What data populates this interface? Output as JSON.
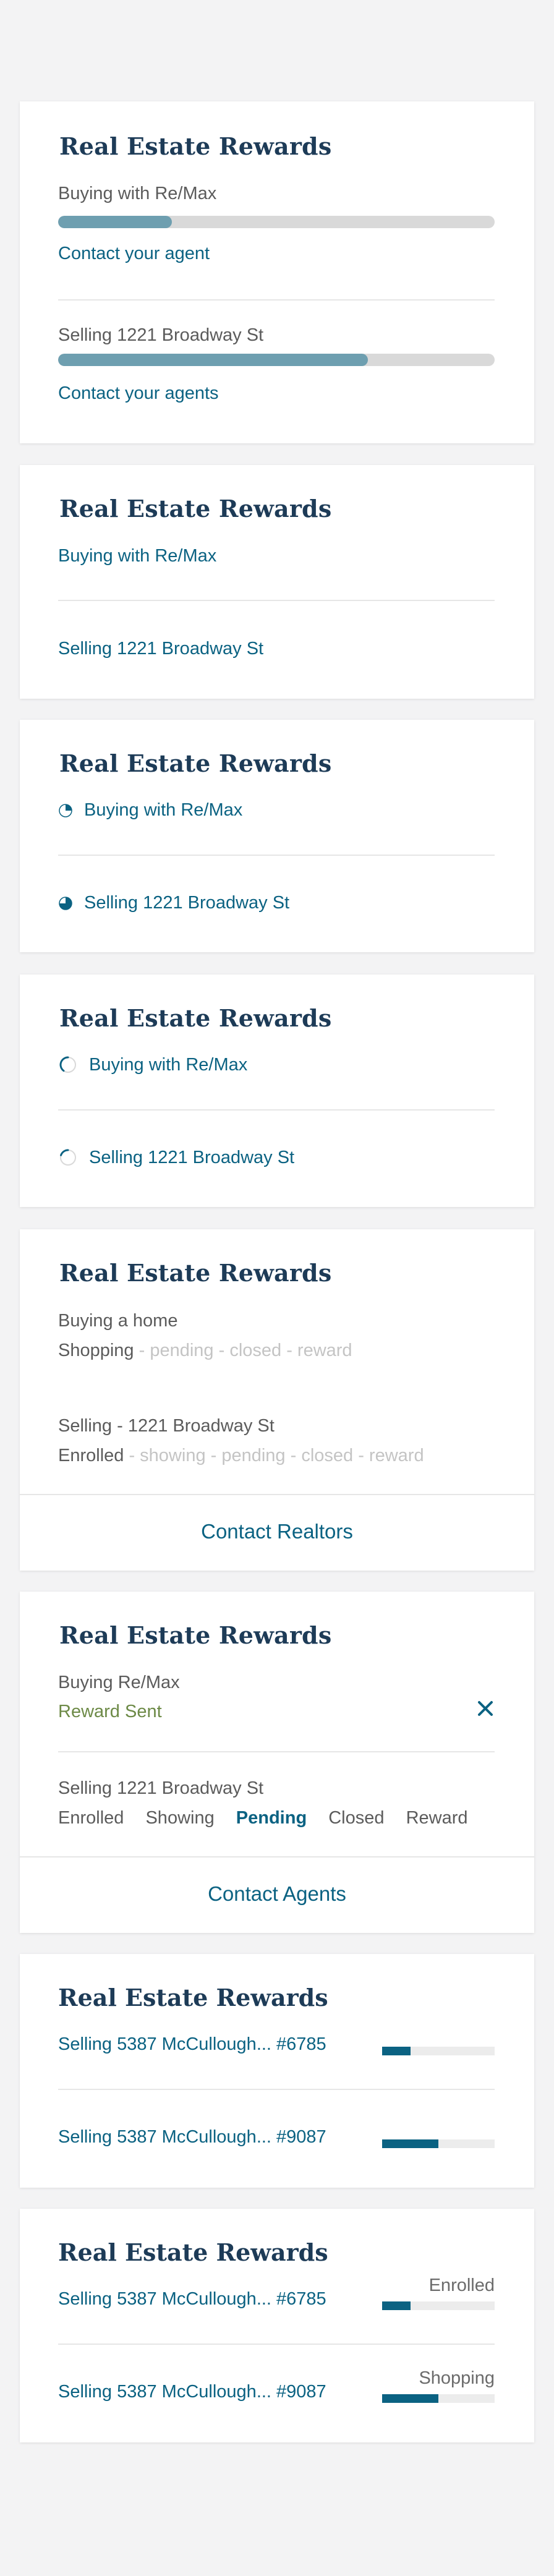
{
  "cards": [
    {
      "title": "Real Estate Rewards",
      "items": [
        {
          "label": "Buying with Re/Max",
          "progress": 0.26,
          "link": "Contact your agent"
        },
        {
          "label": "Selling 1221 Broadway St",
          "progress": 0.71,
          "link": "Contact your agents"
        }
      ]
    },
    {
      "title": "Real Estate Rewards",
      "items": [
        {
          "label": "Buying with Re/Max"
        },
        {
          "label": "Selling 1221 Broadway St"
        }
      ]
    },
    {
      "title": "Real Estate Rewards",
      "items": [
        {
          "label": "Buying with Re/Max",
          "icon": "pie-chart-icon",
          "progress": 0.25
        },
        {
          "label": "Selling 1221 Broadway St",
          "icon": "pie-chart-icon",
          "progress": 0.75
        }
      ]
    },
    {
      "title": "Real Estate Rewards",
      "items": [
        {
          "label": "Buying with Re/Max",
          "icon": "progress-ring-icon",
          "progress": 0.4
        },
        {
          "label": "Selling 1221 Broadway St",
          "icon": "progress-ring-icon",
          "progress": 0.2
        }
      ]
    },
    {
      "title": "Real Estate Rewards",
      "items": [
        {
          "heading": "Buying a home",
          "current": "Shopping",
          "rest": " - pending - closed - reward"
        },
        {
          "heading": "Selling - 1221 Broadway St",
          "current": "Enrolled",
          "rest": " - showing - pending - closed - reward"
        }
      ],
      "button": "Contact Realtors"
    },
    {
      "title": "Real Estate Rewards",
      "buying": {
        "heading": "Buying Re/Max",
        "status": "Reward Sent"
      },
      "selling": {
        "heading": "Selling 1221 Broadway St",
        "stages": [
          "Enrolled",
          "Showing",
          "Pending",
          "Closed",
          "Reward"
        ],
        "active_stage": "Pending"
      },
      "button": "Contact Agents",
      "close_icon": "close-icon"
    },
    {
      "title": "Real Estate Rewards",
      "items": [
        {
          "label": "Selling 5387 McCullough...",
          "id": "#6785",
          "progress": 0.25
        },
        {
          "label": "Selling 5387 McCullough...",
          "id": "#9087",
          "progress": 0.5
        }
      ]
    },
    {
      "title": "Real Estate Rewards",
      "items": [
        {
          "label": "Selling 5387 McCullough...",
          "id": "#6785",
          "status": "Enrolled",
          "progress": 0.25
        },
        {
          "label": "Selling 5387 McCullough...",
          "id": "#9087",
          "status": "Shopping",
          "progress": 0.5
        }
      ]
    }
  ],
  "colors": {
    "title": "#1d3b57",
    "link": "#0b6282",
    "bar_fill": "#6e9fb0",
    "bar_track": "#d9d9d9",
    "mini_fill": "#0b6282",
    "green": "#6d8a47"
  }
}
